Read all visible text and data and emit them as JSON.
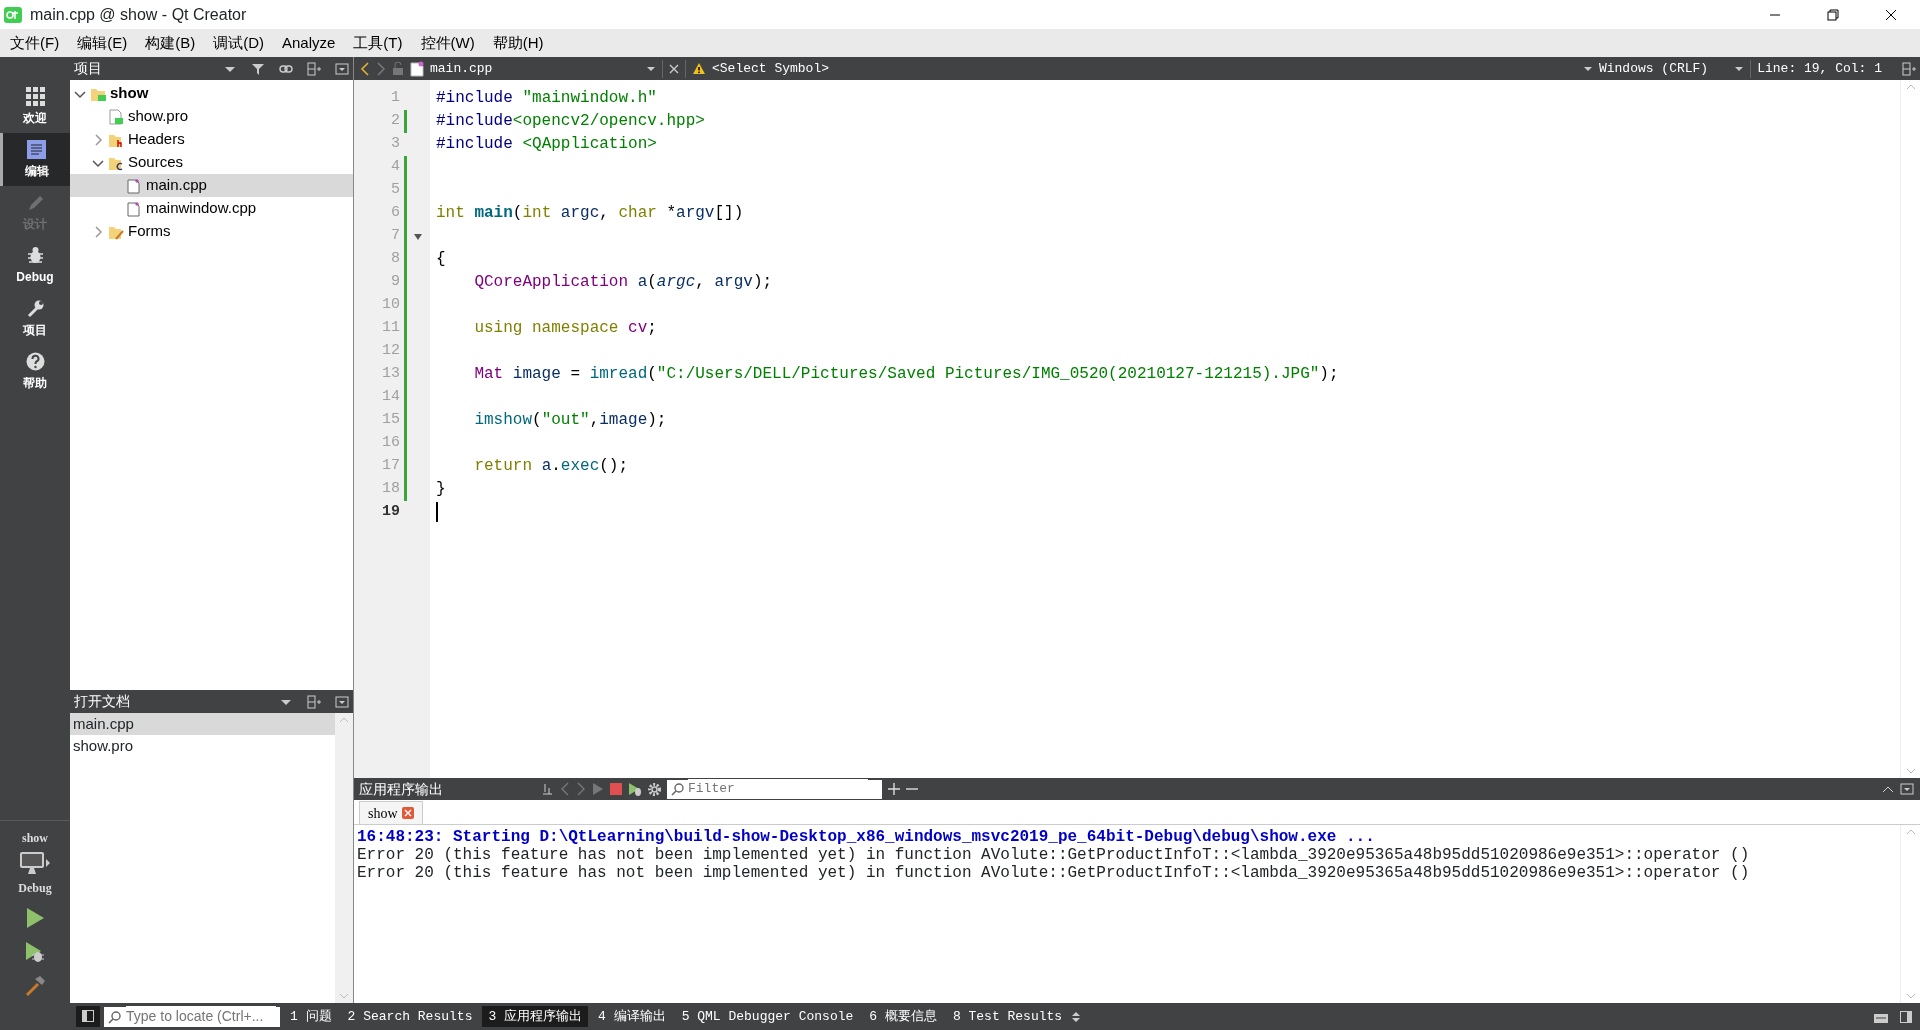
{
  "window": {
    "title": "main.cpp @ show - Qt Creator"
  },
  "menu": [
    "文件(F)",
    "编辑(E)",
    "构建(B)",
    "调试(D)",
    "Analyze",
    "工具(T)",
    "控件(W)",
    "帮助(H)"
  ],
  "mode_bar": [
    {
      "label": "欢迎",
      "kind": "welcome",
      "selected": false,
      "disabled": false
    },
    {
      "label": "编辑",
      "kind": "edit",
      "selected": true,
      "disabled": false
    },
    {
      "label": "设计",
      "kind": "design",
      "selected": false,
      "disabled": true
    },
    {
      "label": "Debug",
      "kind": "debug",
      "selected": false,
      "disabled": false
    },
    {
      "label": "项目",
      "kind": "projects",
      "selected": false,
      "disabled": false
    },
    {
      "label": "帮助",
      "kind": "help",
      "selected": false,
      "disabled": false
    }
  ],
  "kit": {
    "project": "show",
    "build_config": "Debug"
  },
  "project_panel": {
    "title": "项目",
    "tree": [
      {
        "label": "show",
        "kind": "project",
        "expanded": true,
        "selected": false,
        "children": [
          {
            "label": "show.pro",
            "kind": "pro-file",
            "selected": false
          },
          {
            "label": "Headers",
            "kind": "headers-folder",
            "expanded": false,
            "selected": false
          },
          {
            "label": "Sources",
            "kind": "sources-folder",
            "expanded": true,
            "selected": false,
            "children": [
              {
                "label": "main.cpp",
                "kind": "cpp-file",
                "selected": true
              },
              {
                "label": "mainwindow.cpp",
                "kind": "cpp-file",
                "selected": false
              }
            ]
          },
          {
            "label": "Forms",
            "kind": "forms-folder",
            "expanded": false,
            "selected": false
          }
        ]
      }
    ]
  },
  "open_documents": {
    "title": "打开文档",
    "items": [
      {
        "label": "main.cpp",
        "selected": true
      },
      {
        "label": "show.pro",
        "selected": false
      }
    ]
  },
  "editor_toolbar": {
    "file": "main.cpp",
    "symbol": "<Select Symbol>",
    "line_ending": "Windows (CRLF)",
    "position": "Line: 19, Col: 1"
  },
  "code": [
    {
      "number": "1",
      "changed": false,
      "current": false,
      "fold": false,
      "indented": false,
      "tokens": [
        {
          "text": "#include ",
          "kind": "preproc"
        },
        {
          "text": "\"mainwindow.h\"",
          "kind": "string"
        }
      ]
    },
    {
      "number": "2",
      "changed": true,
      "current": false,
      "fold": false,
      "indented": false,
      "tokens": [
        {
          "text": "#include",
          "kind": "preproc"
        },
        {
          "text": "<opencv2/opencv.hpp>",
          "kind": "string"
        }
      ]
    },
    {
      "number": "3",
      "changed": false,
      "current": false,
      "fold": false,
      "indented": false,
      "tokens": [
        {
          "text": "#include ",
          "kind": "preproc"
        },
        {
          "text": "<QApplication>",
          "kind": "string"
        }
      ]
    },
    {
      "number": "4",
      "changed": true,
      "current": false,
      "fold": false,
      "indented": false
    },
    {
      "number": "5",
      "changed": true,
      "current": false,
      "fold": false,
      "indented": false
    },
    {
      "number": "6",
      "changed": true,
      "current": false,
      "fold": false,
      "indented": false,
      "tokens": [
        {
          "text": "int ",
          "kind": "keyword"
        },
        {
          "text": "main",
          "kind": "function-decl"
        },
        {
          "text": "(",
          "kind": "plain"
        },
        {
          "text": "int ",
          "kind": "keyword"
        },
        {
          "text": "argc",
          "kind": "variable"
        },
        {
          "text": ", ",
          "kind": "plain"
        },
        {
          "text": "char ",
          "kind": "keyword"
        },
        {
          "text": "*",
          "kind": "plain"
        },
        {
          "text": "argv",
          "kind": "variable"
        },
        {
          "text": "[])",
          "kind": "plain"
        }
      ]
    },
    {
      "number": "7",
      "changed": true,
      "current": false,
      "fold": true,
      "indented": false
    },
    {
      "number": "8",
      "changed": true,
      "current": false,
      "fold": false,
      "indented": false,
      "tokens": [
        {
          "text": "{",
          "kind": "plain"
        }
      ]
    },
    {
      "number": "9",
      "changed": true,
      "current": false,
      "fold": false,
      "indented": true,
      "tokens": [
        {
          "text": "QCoreApplication ",
          "kind": "type"
        },
        {
          "text": "a",
          "kind": "variable"
        },
        {
          "text": "(",
          "kind": "plain"
        },
        {
          "text": "argc",
          "kind": "parameter"
        },
        {
          "text": ", ",
          "kind": "plain"
        },
        {
          "text": "argv",
          "kind": "variable"
        },
        {
          "text": ");",
          "kind": "plain"
        }
      ]
    },
    {
      "number": "10",
      "changed": true,
      "current": false,
      "fold": false,
      "indented": false
    },
    {
      "number": "11",
      "changed": true,
      "current": false,
      "fold": false,
      "indented": true,
      "tokens": [
        {
          "text": "using namespace ",
          "kind": "keyword"
        },
        {
          "text": "cv",
          "kind": "type"
        },
        {
          "text": ";",
          "kind": "plain"
        }
      ]
    },
    {
      "number": "12",
      "changed": true,
      "current": false,
      "fold": false,
      "indented": false
    },
    {
      "number": "13",
      "changed": true,
      "current": false,
      "fold": false,
      "indented": true,
      "tokens": [
        {
          "text": "Mat ",
          "kind": "type"
        },
        {
          "text": "image ",
          "kind": "variable"
        },
        {
          "text": "= ",
          "kind": "plain"
        },
        {
          "text": "imread",
          "kind": "function"
        },
        {
          "text": "(",
          "kind": "plain"
        },
        {
          "text": "\"C:/Users/DELL/Pictures/Saved Pictures/IMG_0520(20210127-121215).JPG\"",
          "kind": "string"
        },
        {
          "text": ");",
          "kind": "plain"
        }
      ]
    },
    {
      "number": "14",
      "changed": true,
      "current": false,
      "fold": false,
      "indented": false
    },
    {
      "number": "15",
      "changed": true,
      "current": false,
      "fold": false,
      "indented": true,
      "tokens": [
        {
          "text": "imshow",
          "kind": "function"
        },
        {
          "text": "(",
          "kind": "plain"
        },
        {
          "text": "\"out\"",
          "kind": "string"
        },
        {
          "text": ",",
          "kind": "plain"
        },
        {
          "text": "image",
          "kind": "variable"
        },
        {
          "text": ");",
          "kind": "plain"
        }
      ]
    },
    {
      "number": "16",
      "changed": true,
      "current": false,
      "fold": false,
      "indented": false
    },
    {
      "number": "17",
      "changed": true,
      "current": false,
      "fold": false,
      "indented": true,
      "tokens": [
        {
          "text": "return ",
          "kind": "keyword"
        },
        {
          "text": "a",
          "kind": "variable"
        },
        {
          "text": ".",
          "kind": "plain"
        },
        {
          "text": "exec",
          "kind": "function"
        },
        {
          "text": "();",
          "kind": "plain"
        }
      ]
    },
    {
      "number": "18",
      "changed": true,
      "current": false,
      "fold": false,
      "indented": false,
      "tokens": [
        {
          "text": "}",
          "kind": "plain"
        }
      ]
    },
    {
      "number": "19",
      "changed": false,
      "current": true,
      "fold": false,
      "indented": false
    }
  ],
  "output": {
    "title": "应用程序输出",
    "filter": {
      "placeholder": "Filter"
    },
    "tabs": [
      {
        "label": "show",
        "selected": true
      }
    ],
    "lines": [
      {
        "kind": "info",
        "text": "16:48:23: Starting D:\\QtLearning\\build-show-Desktop_x86_windows_msvc2019_pe_64bit-Debug\\debug\\show.exe ..."
      },
      {
        "kind": "error",
        "text": "Error 20 (this feature has not been implemented yet) in function AVolute::GetProductInfoT::<lambda_3920e95365a48b95dd51020986e9e351>::operator ()"
      },
      {
        "kind": "error",
        "text": "Error 20 (this feature has not been implemented yet) in function AVolute::GetProductInfoT::<lambda_3920e95365a48b95dd51020986e9e351>::operator ()"
      }
    ]
  },
  "status_bar": {
    "locator": {
      "placeholder": "Type to locate (Ctrl+..."
    },
    "panes": [
      {
        "label": "1 问题",
        "selected": false
      },
      {
        "label": "2 Search Results",
        "selected": false
      },
      {
        "label": "3 应用程序输出",
        "selected": true
      },
      {
        "label": "4 编译输出",
        "selected": false
      },
      {
        "label": "5 QML Debugger Console",
        "selected": false
      },
      {
        "label": "6 概要信息",
        "selected": false
      },
      {
        "label": "8 Test Results",
        "selected": false
      }
    ]
  }
}
